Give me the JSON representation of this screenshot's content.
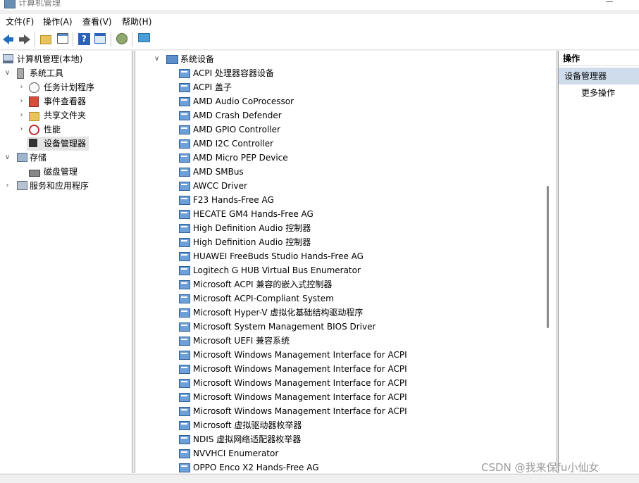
{
  "window": {
    "title": "计算机管理"
  },
  "menubar": {
    "items": [
      "文件(F)",
      "操作(A)",
      "查看(V)",
      "帮助(H)"
    ]
  },
  "toolbar": {
    "icons": [
      "back-icon",
      "forward-icon",
      "folder-up-icon",
      "show-hide-tree-icon",
      "help-icon",
      "properties-icon",
      "scan-hardware-icon",
      "monitor-icon"
    ]
  },
  "tree": {
    "root": "计算机管理(本地)",
    "system_tools": "系统工具",
    "task_scheduler": "任务计划程序",
    "event_viewer": "事件查看器",
    "shared_folders": "共享文件夹",
    "performance": "性能",
    "device_manager": "设备管理器",
    "storage": "存储",
    "disk_management": "磁盘管理",
    "services_apps": "服务和应用程序"
  },
  "devices": {
    "category": "系统设备",
    "items": [
      "ACPI 处理器容器设备",
      "ACPI 盖子",
      "AMD Audio CoProcessor",
      "AMD Crash Defender",
      "AMD GPIO Controller",
      "AMD I2C Controller",
      "AMD Micro PEP Device",
      "AMD SMBus",
      "AWCC Driver",
      "F23 Hands-Free AG",
      "HECATE GM4 Hands-Free AG",
      "High Definition Audio 控制器",
      "High Definition Audio 控制器",
      "HUAWEI FreeBuds Studio Hands-Free AG",
      "Logitech G HUB Virtual Bus Enumerator",
      "Microsoft ACPI 兼容的嵌入式控制器",
      "Microsoft ACPI-Compliant System",
      "Microsoft Hyper-V 虚拟化基础结构驱动程序",
      "Microsoft System Management BIOS Driver",
      "Microsoft UEFI 兼容系统",
      "Microsoft Windows Management Interface for ACPI",
      "Microsoft Windows Management Interface for ACPI",
      "Microsoft Windows Management Interface for ACPI",
      "Microsoft Windows Management Interface for ACPI",
      "Microsoft Windows Management Interface for ACPI",
      "Microsoft 虚拟驱动器枚举器",
      "NDIS 虚拟网络适配器枚举器",
      "NVVHCI Enumerator",
      "OPPO Enco X2 Hands-Free AG"
    ]
  },
  "actions": {
    "header": "操作",
    "section": "设备管理器",
    "more": "更多操作"
  },
  "watermark": "CSDN @我来保fu小仙女"
}
